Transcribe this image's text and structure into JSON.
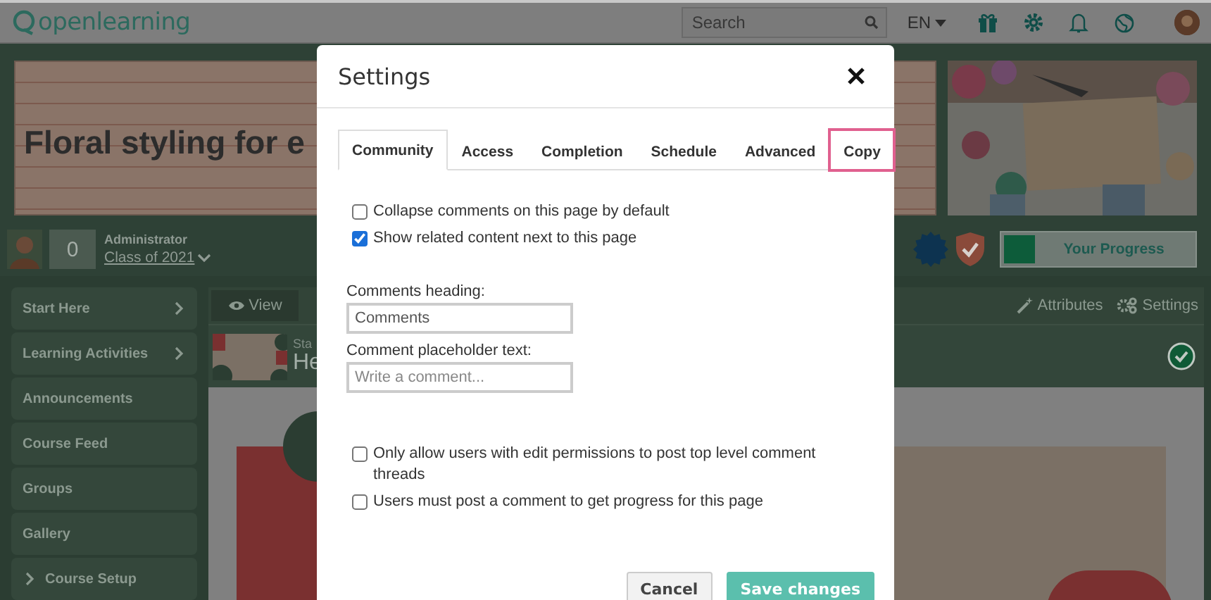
{
  "topbar": {
    "logo": "openlearning",
    "search": {
      "placeholder": "Search"
    },
    "language": "EN"
  },
  "course": {
    "title": "Floral styling for e",
    "points": "0",
    "role": "Administrator",
    "cohort": "Class of 2021",
    "progress_label": "Your Progress"
  },
  "sidebar": {
    "items": [
      {
        "label": "Start Here",
        "kind": "submenu"
      },
      {
        "label": "Learning Activities",
        "kind": "submenu"
      },
      {
        "label": "Announcements",
        "kind": "link"
      },
      {
        "label": "Course Feed",
        "kind": "link"
      },
      {
        "label": "Groups",
        "kind": "link"
      },
      {
        "label": "Gallery",
        "kind": "link"
      },
      {
        "label": "Course Setup",
        "kind": "group"
      }
    ]
  },
  "page_toolbar": {
    "view_button": "View",
    "actions": [
      {
        "label": "Attributes",
        "kind": "attributes"
      },
      {
        "label": "Settings",
        "kind": "settings"
      }
    ]
  },
  "page_header": {
    "breadcrumb": "Sta",
    "title": "He",
    "completed": true
  },
  "dialog": {
    "title": "Settings",
    "tabs": [
      {
        "label": "Community",
        "selected": true,
        "focused": false
      },
      {
        "label": "Access",
        "selected": false,
        "focused": false
      },
      {
        "label": "Completion",
        "selected": false,
        "focused": false
      },
      {
        "label": "Schedule",
        "selected": false,
        "focused": false
      },
      {
        "label": "Advanced",
        "selected": false,
        "focused": false
      },
      {
        "label": "Copy",
        "selected": false,
        "focused": true
      }
    ],
    "options_top": [
      {
        "label": "Collapse comments on this page by default",
        "checked": false
      },
      {
        "label": "Show related content next to this page",
        "checked": true
      }
    ],
    "fields": [
      {
        "label": "Comments heading:",
        "value": "Comments"
      },
      {
        "label": "Comment placeholder text:",
        "placeholder": "Write a comment..."
      }
    ],
    "options_bottom": [
      {
        "label": "Only allow users with edit permissions to post top level comment threads",
        "checked": false
      },
      {
        "label": "Users must post a comment to get progress for this page",
        "checked": false
      }
    ],
    "buttons": [
      {
        "label": "Cancel",
        "kind": "secondary"
      },
      {
        "label": "Save changes",
        "kind": "primary"
      }
    ]
  }
}
